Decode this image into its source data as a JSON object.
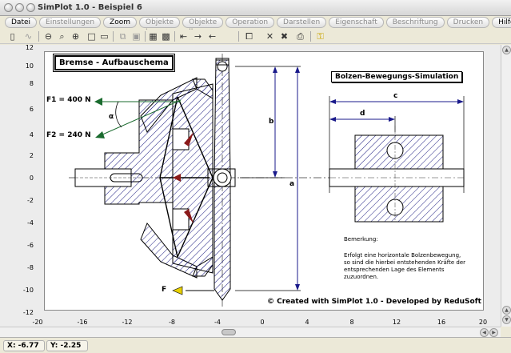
{
  "window": {
    "title": "SimPlot 1.0 - Beispiel 6"
  },
  "menu": [
    "Datei",
    "Einstellungen",
    "Zoom",
    "Objekte I",
    "Objekte II",
    "Operation",
    "Darstellen",
    "Eigenschaft",
    "Beschriftung",
    "Drucken",
    "Hilfe"
  ],
  "axes": {
    "y_ticks": [
      "12",
      "10",
      "8",
      "6",
      "4",
      "2",
      "0",
      "-2",
      "-4",
      "-6",
      "-8",
      "-10",
      "-12"
    ],
    "x_ticks": [
      "-20",
      "-16",
      "-12",
      "-8",
      "-4",
      "0",
      "4",
      "8",
      "12",
      "16",
      "20"
    ]
  },
  "drawing": {
    "title_left": "Bremse - Aufbauschema",
    "title_right": "Bolzen-Bewegungs-Simulation",
    "force1": "F1 = 400 N",
    "force2": "F2 = 240 N",
    "force_f": "F",
    "alpha": "α",
    "dim_a": "a",
    "dim_b": "b",
    "dim_c": "c",
    "dim_d": "d",
    "remark_title": "Bemerkung:",
    "remark_lines": [
      "Erfolgt eine horizontale Bolzenbewegung,",
      "so sind die hierbei entstehenden Kräfte der",
      "entsprechenden Lage des Elements",
      "zuzuordnen."
    ],
    "credit": "© Created with SimPlot 1.0 - Developed by ReduSoft"
  },
  "status": {
    "x": "X: -6.77",
    "y": "Y: -2.25"
  },
  "colors": {
    "arrow_green": "#1a6b2e",
    "arrow_red": "#8b1a1a",
    "arrow_blue": "#1a1a8b",
    "arrow_yellow": "#e8d000",
    "hatch": "#1a1a80"
  }
}
